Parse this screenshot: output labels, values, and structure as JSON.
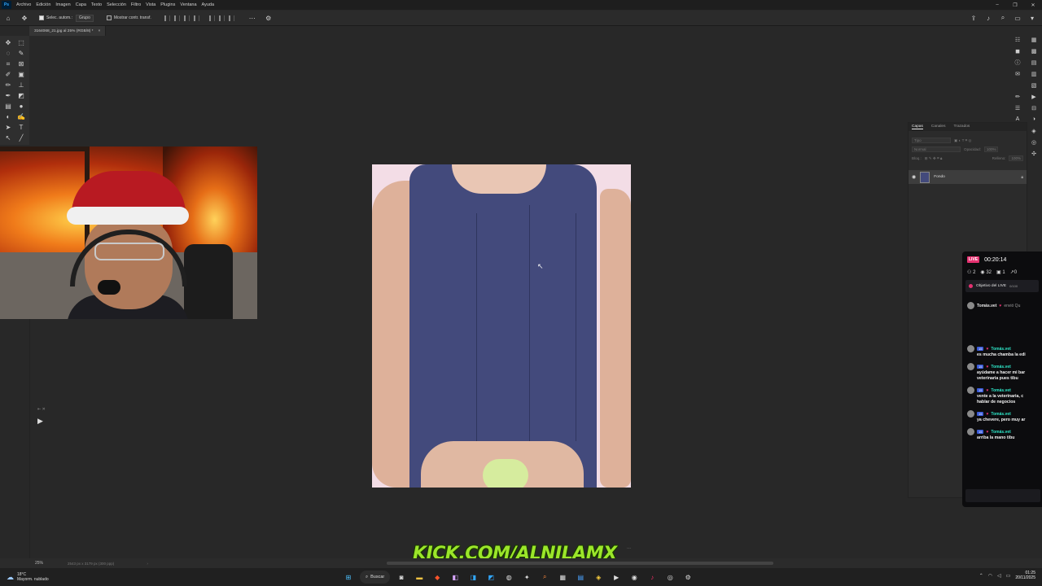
{
  "app": {
    "menu": [
      "Archivo",
      "Edición",
      "Imagen",
      "Capa",
      "Texto",
      "Selección",
      "Filtro",
      "Vista",
      "Plugins",
      "Ventana",
      "Ayuda"
    ],
    "logo_text": "Ps"
  },
  "options": {
    "auto_select_label": "Selec. autom.:",
    "group_value": "Grupo",
    "transform_label": "Mostrar contr. transf."
  },
  "document": {
    "tab_title": "3164068_21.jpg al 25% (RGB/8) *",
    "tab_close": "×"
  },
  "layers_panel": {
    "tabs": [
      "Capas",
      "Canales",
      "Trazados"
    ],
    "search_placeholder": "Tipo",
    "blend_mode": "Normal",
    "opacity_label": "Opacidad:",
    "opacity_value": "100%",
    "lock_label": "Bloq.:",
    "fill_label": "Relleno:",
    "fill_value": "100%",
    "layer_name": "Fondo",
    "bottom_icons": [
      "GO",
      "fx"
    ]
  },
  "live_chat": {
    "live_badge": "LIVE",
    "duration": "00:20:14",
    "stats": [
      "2",
      "32",
      "1",
      "0"
    ],
    "goal_label": "Objetivo del LIVE",
    "goal_progress": "0/100",
    "gift_user": "Tomás.vet",
    "gift_text": "envió Qu",
    "messages": [
      {
        "badge": "15",
        "user": "Tomás.vet",
        "text": [
          "es mucha chamba la edi"
        ]
      },
      {
        "badge": "15",
        "user": "Tomás.vet",
        "text": [
          "ayúdame a hacer mi bar",
          "veterinaria pues tibu"
        ]
      },
      {
        "badge": "15",
        "user": "Tomás.vet",
        "text": [
          "vente a la veterinaria, c",
          "hablar de negocios"
        ]
      },
      {
        "badge": "15",
        "user": "Tomás.vet",
        "text": [
          "ya chevere, pero muy ar"
        ]
      },
      {
        "badge": "15",
        "user": "Tomás.vet",
        "text": [
          "arriba la mano tibu"
        ]
      }
    ]
  },
  "status": {
    "zoom": "25%",
    "doc_info": "2543 px x 3179 px (300 ppp)"
  },
  "watermark": "KICK.COM/ALNILAMX",
  "taskbar": {
    "temperature": "18°C",
    "weather": "Mayorm. nublado",
    "search": "Buscar",
    "time": "01:25",
    "date": "20/11/2025"
  }
}
